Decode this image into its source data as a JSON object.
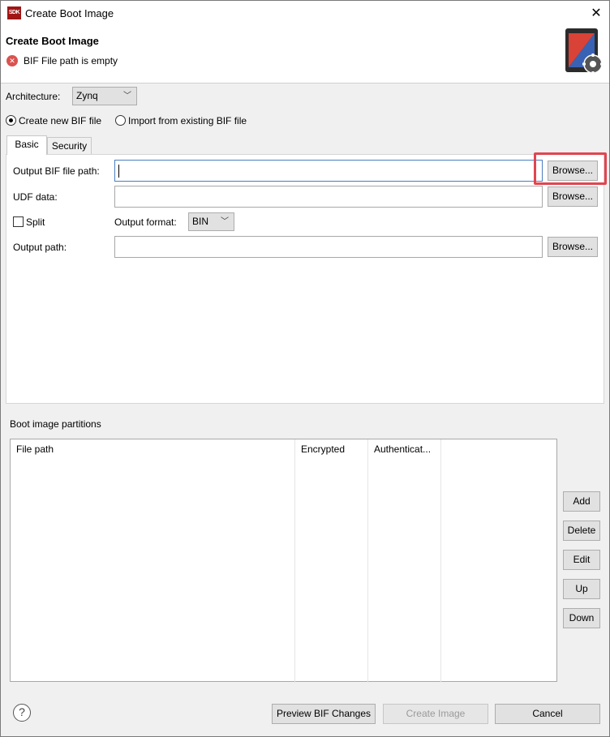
{
  "window": {
    "app_badge": "SDK",
    "title": "Create Boot Image",
    "close_glyph": "✕"
  },
  "header": {
    "title": "Create Boot Image",
    "error_message": "BIF File path is empty",
    "error_icon": "error-icon",
    "banner_icon": "boot-image-gear-icon"
  },
  "architecture": {
    "label": "Architecture:",
    "value": "Zynq"
  },
  "bif_mode": {
    "create_label": "Create new BIF file",
    "import_label": "Import from existing BIF file",
    "selected": "create"
  },
  "tabs": [
    {
      "label": "Basic",
      "active": true
    },
    {
      "label": "Security",
      "active": false
    }
  ],
  "basic": {
    "output_bif_label": "Output BIF file path:",
    "output_bif_value": "",
    "udf_label": "UDF data:",
    "udf_value": "",
    "split_label": "Split",
    "split_checked": false,
    "output_format_label": "Output format:",
    "output_format_value": "BIN",
    "output_path_label": "Output path:",
    "output_path_value": "",
    "browse_label": "Browse..."
  },
  "partitions": {
    "section_label": "Boot image partitions",
    "columns": [
      "File path",
      "Encrypted",
      "Authenticat..."
    ],
    "rows": [],
    "add_label": "Add",
    "delete_label": "Delete",
    "edit_label": "Edit",
    "up_label": "Up",
    "down_label": "Down"
  },
  "footer": {
    "help_glyph": "?",
    "preview_label": "Preview BIF Changes",
    "create_label": "Create Image",
    "cancel_label": "Cancel"
  },
  "colors": {
    "highlight": "#e0454f",
    "error": "#d9534f",
    "focus_border": "#4a7fc0"
  }
}
